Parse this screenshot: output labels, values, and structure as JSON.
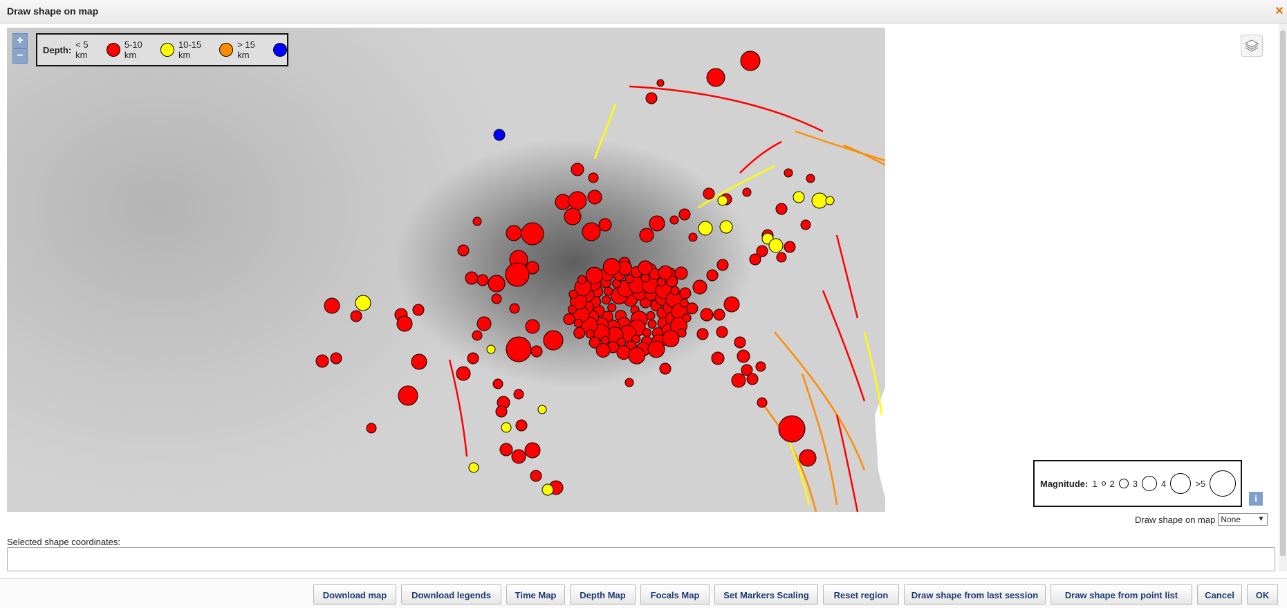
{
  "window": {
    "title": "Draw shape on map",
    "close_icon": "close-icon"
  },
  "map": {
    "zoom_in": "+",
    "zoom_out": "−",
    "depth_legend": {
      "title": "Depth:",
      "items": [
        {
          "label": "< 5 km",
          "color": "#ff0000"
        },
        {
          "label": "5-10 km",
          "color": "#ffff00"
        },
        {
          "label": "10-15 km",
          "color": "#ff8c00"
        },
        {
          "label": "> 15 km",
          "color": "#0000ff"
        }
      ]
    },
    "magnitude_legend": {
      "title": "Magnitude:",
      "items": [
        "1",
        "2",
        "3",
        "4",
        ">5"
      ]
    },
    "info_label": "i",
    "layers_icon": "layers-icon"
  },
  "draw_control": {
    "label": "Draw shape on map",
    "value": "None"
  },
  "coordinates": {
    "label": "Selected shape coordinates:",
    "value": ""
  },
  "buttons": [
    "Download map",
    "Download legends",
    "Time Map",
    "Depth Map",
    "Focals Map",
    "Set Markers Scaling",
    "Reset region",
    "Draw shape from last session",
    "Draw shape from point list",
    "Cancel",
    "OK"
  ]
}
